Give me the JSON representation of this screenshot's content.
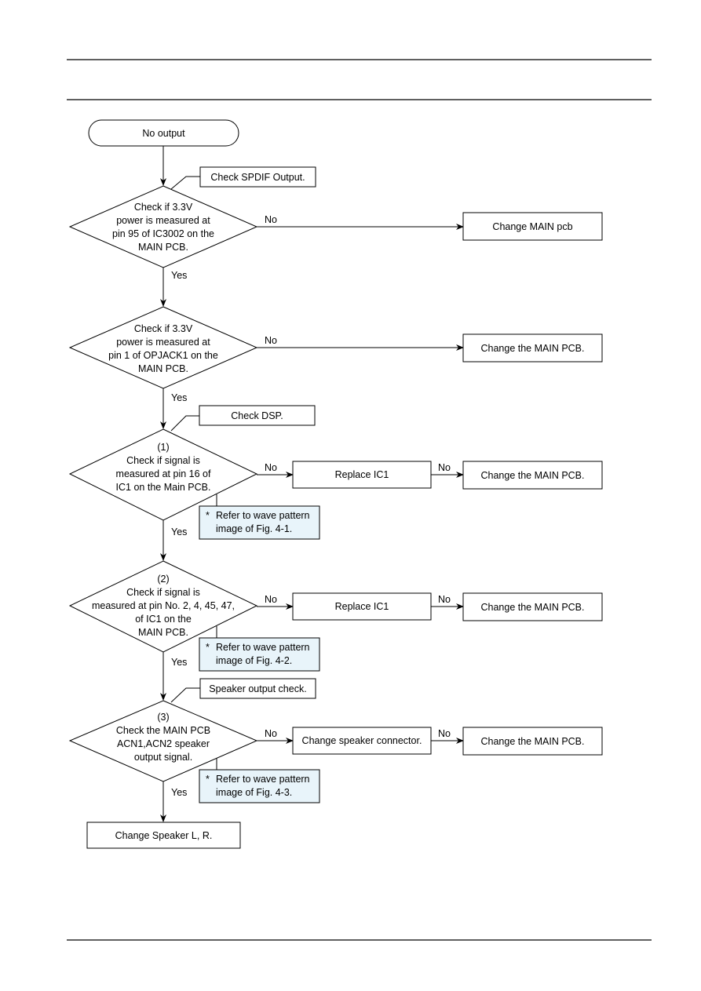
{
  "flowchart": {
    "start": "No output",
    "callouts": {
      "spdif": "Check SPDIF Output.",
      "dsp": "Check DSP.",
      "speaker": "Speaker output check."
    },
    "decisions": [
      {
        "lines": [
          "Check if 3.3V",
          "power is measured at",
          "pin 95 of IC3002 on the",
          "MAIN PCB."
        ]
      },
      {
        "lines": [
          "Check if 3.3V",
          "power is measured at",
          "pin 1 of OPJACK1 on the",
          "MAIN PCB."
        ]
      },
      {
        "lines": [
          "(1)",
          "Check if signal is",
          "measured at pin 16 of",
          "IC1 on the Main PCB."
        ]
      },
      {
        "lines": [
          "(2)",
          "Check if signal is",
          "measured at pin No. 2, 4, 45, 47,",
          "of  IC1 on the",
          "MAIN PCB."
        ]
      },
      {
        "lines": [
          "(3)",
          "Check the MAIN PCB",
          "ACN1,ACN2 speaker",
          "output signal."
        ]
      }
    ],
    "actions": {
      "d1_no": "Change MAIN pcb",
      "d2_no": "Change the MAIN PCB.",
      "d3_no": "Replace IC1",
      "d3_no2": "Change the MAIN PCB.",
      "d4_no": "Replace IC1",
      "d4_no2": "Change the MAIN PCB.",
      "d5_no": "Change speaker connector.",
      "d5_no2": "Change the MAIN PCB.",
      "d5_yes": "Change Speaker L, R."
    },
    "notes": [
      {
        "bullet": "*",
        "lines": [
          "Refer to wave pattern",
          "image of Fig. 4-1."
        ]
      },
      {
        "bullet": "*",
        "lines": [
          "Refer to wave pattern",
          "image of Fig. 4-2."
        ]
      },
      {
        "bullet": "*",
        "lines": [
          "Refer to wave pattern",
          "image of Fig. 4-3."
        ]
      }
    ],
    "labels": {
      "yes": "Yes",
      "no": "No"
    }
  },
  "colors": {
    "note_fill": "#e8f4fa",
    "line": "#000000"
  }
}
